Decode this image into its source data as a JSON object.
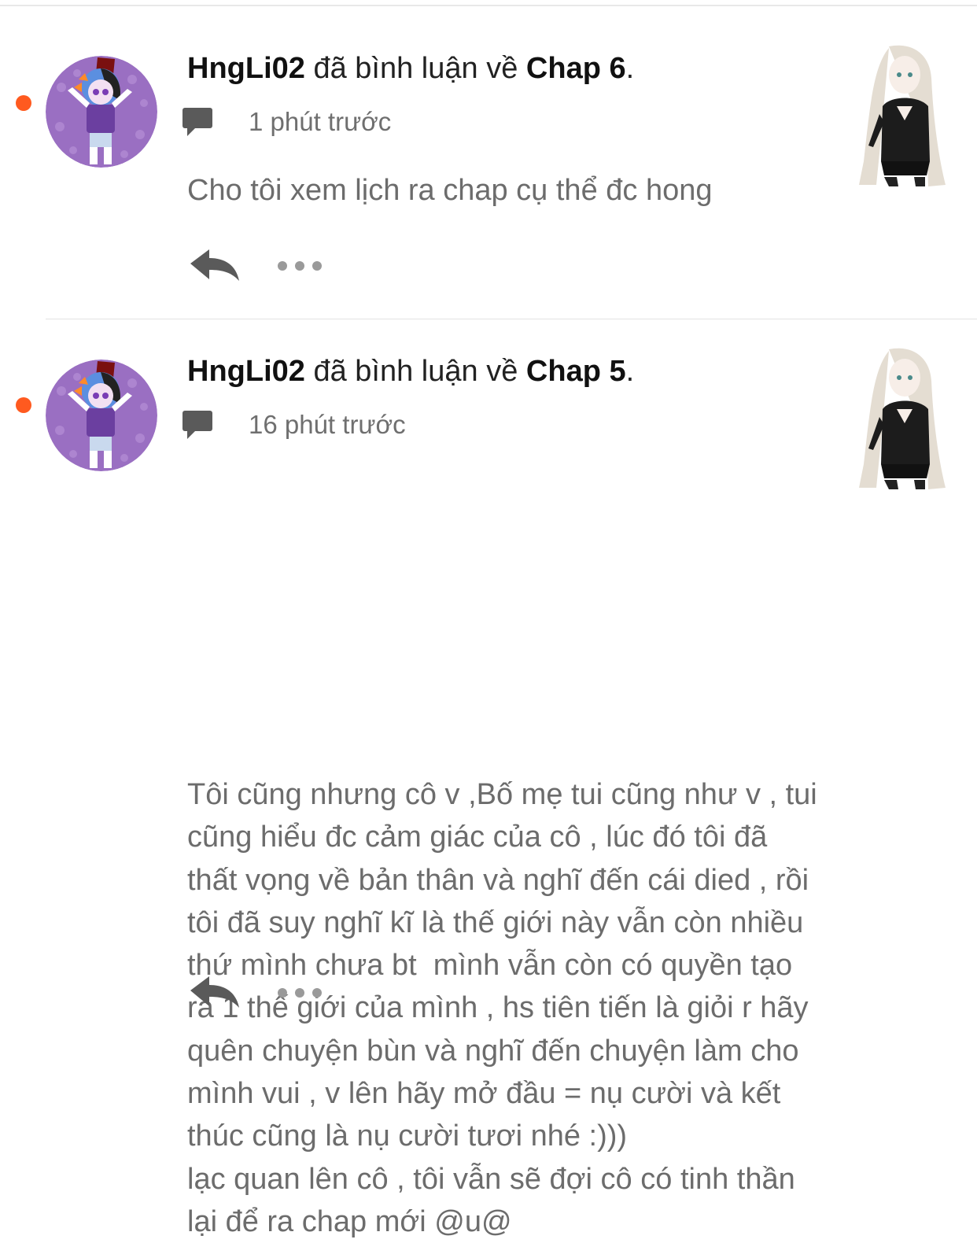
{
  "notifications": [
    {
      "username": "HngLi02",
      "action_text": "đã bình luận về",
      "target": "Chap 6",
      "period": ".",
      "time": "1 phút trước",
      "comment": "Cho tôi xem lịch ra chap cụ thể đc hong",
      "unread": true
    },
    {
      "username": "HngLi02",
      "action_text": "đã bình luận về",
      "target": "Chap 5",
      "period": ".",
      "time": "16 phút trước",
      "comment": "Tôi cũng nhưng cô v ,Bố mẹ tui cũng như v , tui\ncũng hiểu đc cảm giác của cô , lúc đó tôi đã\nthất vọng về bản thân và nghĩ đến cái died , rồi\ntôi đã suy nghĩ kĩ là thế giới này vẫn còn nhiều\nthứ mình chưa bt  mình vẫn còn có quyền tạo\nra 1 thế giới của mình , hs tiên tiến là giỏi r hãy\nquên chuyện bùn và nghĩ đến chuyện làm cho\nmình vui , v lên hãy mở đầu = nụ cười và kết\nthúc cũng là nụ cười tươi nhé :)))\nlạc quan lên cô , tôi vẫn sẽ đợi cô có tinh thần\nlại để ra chap mới @u@",
      "unread": true
    }
  ],
  "icons": {
    "comment": "comment-icon",
    "reply": "reply-icon",
    "more": "more-options-icon"
  },
  "colors": {
    "unread_dot": "#ff5a1f",
    "icon_gray": "#5a5a5a",
    "text_gray": "#6c6c6c"
  }
}
